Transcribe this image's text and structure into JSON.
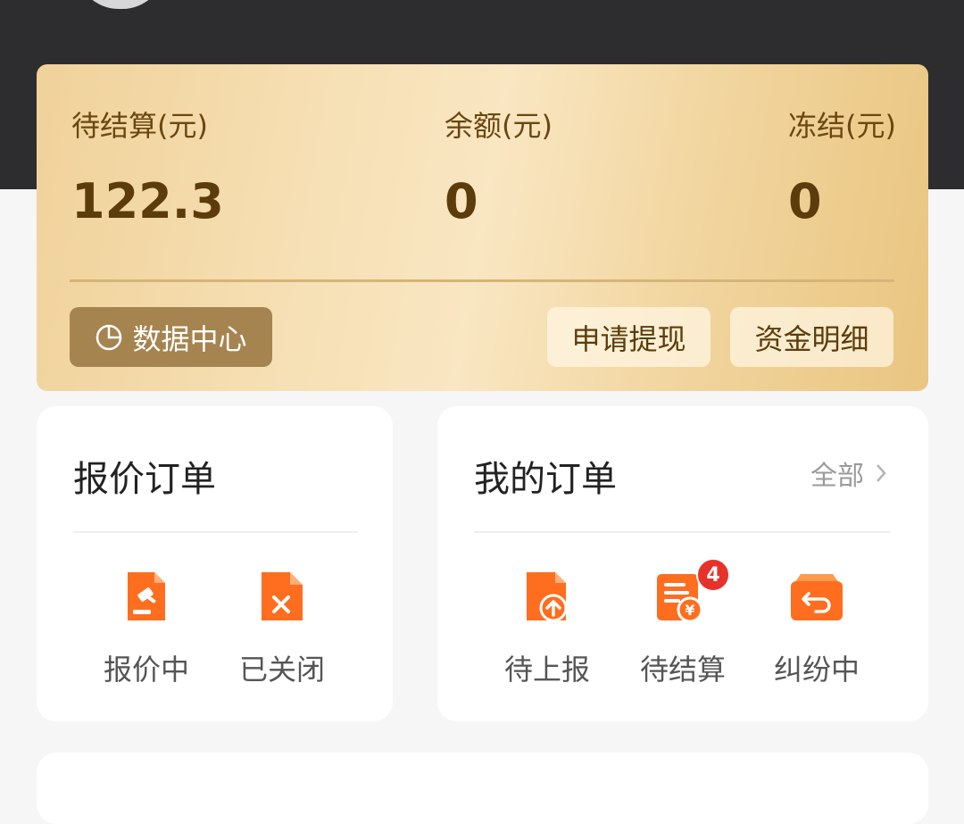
{
  "wallet": {
    "pending_label": "待结算(元)",
    "pending_value": "122.3",
    "balance_label": "余额(元)",
    "balance_value": "0",
    "frozen_label": "冻结(元)",
    "frozen_value": "0",
    "data_center": "数据中心",
    "withdraw": "申请提现",
    "details": "资金明细"
  },
  "quote_orders": {
    "title": "报价订单",
    "items": [
      {
        "label": "报价中",
        "icon": "auction-hammer-icon"
      },
      {
        "label": "已关闭",
        "icon": "closed-document-icon"
      }
    ]
  },
  "my_orders": {
    "title": "我的订单",
    "more": "全部",
    "items": [
      {
        "label": "待上报",
        "icon": "upload-document-icon"
      },
      {
        "label": "待结算",
        "icon": "settlement-icon",
        "badge": "4"
      },
      {
        "label": "纠纷中",
        "icon": "return-box-icon"
      }
    ]
  },
  "colors": {
    "accent": "#ff6a1a",
    "gold_text": "#5c3c0b",
    "badge": "#e8312b",
    "header_bg": "#2d2d2f"
  }
}
